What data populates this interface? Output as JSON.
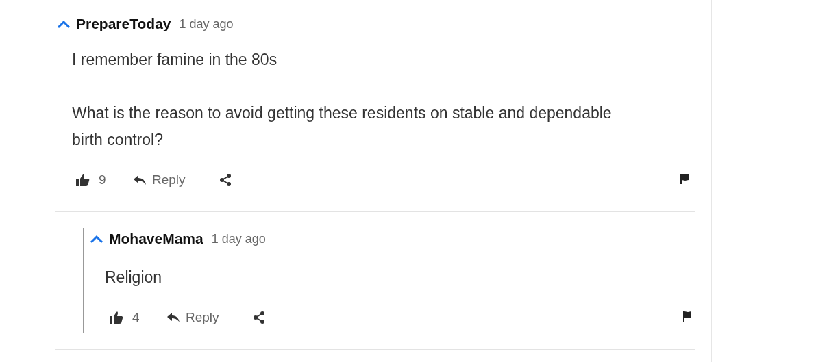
{
  "comments": [
    {
      "username": "PrepareToday",
      "time": "1 day ago",
      "paragraphs": [
        "I remember famine in the 80s",
        "What is the reason to avoid getting these residents on stable and dependable birth control?"
      ],
      "likes": "9",
      "reply_label": "Reply",
      "children": [
        {
          "username": "MohaveMama",
          "time": "1 day ago",
          "paragraphs": [
            "Religion"
          ],
          "likes": "4",
          "reply_label": "Reply"
        }
      ]
    }
  ]
}
